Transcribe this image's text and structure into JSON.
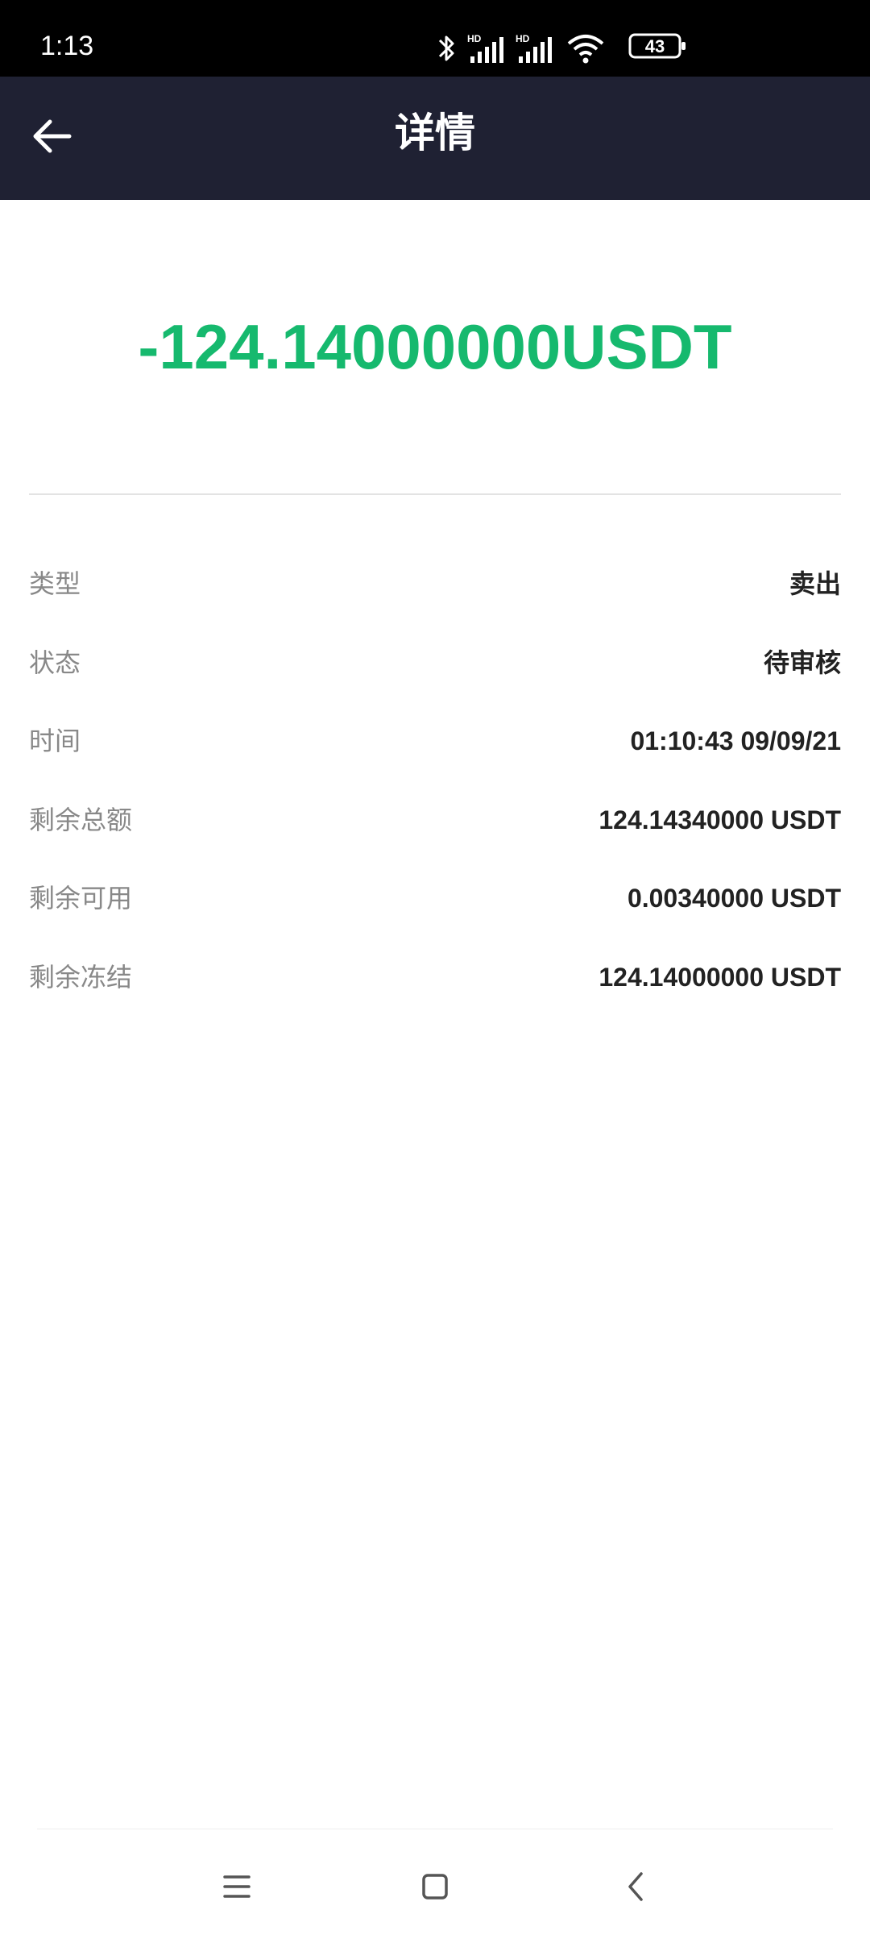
{
  "status_bar": {
    "time": "1:13",
    "battery": "43"
  },
  "header": {
    "title": "详情",
    "back_icon": "arrow-left-icon"
  },
  "amount": "-124.14000000USDT",
  "colors": {
    "accent_green": "#16b96e",
    "header_bg": "#1f2133"
  },
  "details": [
    {
      "label": "类型",
      "value": "卖出"
    },
    {
      "label": "状态",
      "value": "待审核"
    },
    {
      "label": "时间",
      "value": "01:10:43 09/09/21"
    },
    {
      "label": "剩余总额",
      "value": "124.14340000 USDT"
    },
    {
      "label": "剩余可用",
      "value": "0.00340000 USDT"
    },
    {
      "label": "剩余冻结",
      "value": "124.14000000 USDT"
    }
  ],
  "nav": {
    "menu_icon": "menu-icon",
    "home_icon": "home-square-icon",
    "back_icon": "back-chevron-icon"
  }
}
